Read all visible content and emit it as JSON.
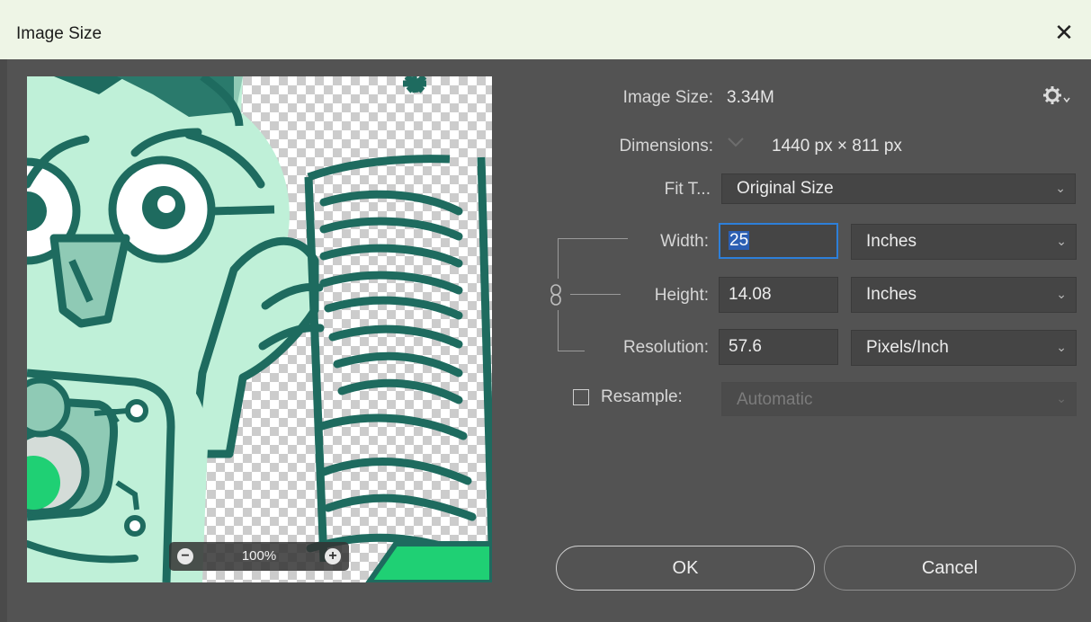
{
  "window": {
    "title": "Image Size",
    "close_glyph": "✕"
  },
  "preview": {
    "zoom_level": "100%",
    "zoom_out_glyph": "−",
    "zoom_in_glyph": "+"
  },
  "info": {
    "image_size_label": "Image Size:",
    "image_size_value": "3.34M",
    "dimensions_label": "Dimensions:",
    "dimensions_value": "1440 px  ×  811 px"
  },
  "fit_to": {
    "label": "Fit T...",
    "value": "Original Size"
  },
  "width": {
    "label": "Width:",
    "value": "25",
    "unit": "Inches"
  },
  "height": {
    "label": "Height:",
    "value": "14.08",
    "unit": "Inches"
  },
  "resolution": {
    "label": "Resolution:",
    "value": "57.6",
    "unit": "Pixels/Inch"
  },
  "resample": {
    "label": "Resample:",
    "value": "Automatic",
    "checked": false
  },
  "buttons": {
    "ok": "OK",
    "cancel": "Cancel"
  },
  "icons": [
    "gear-icon",
    "chain-link-icon",
    "chevron-down-icon",
    "close-icon",
    "zoom-out-icon",
    "zoom-in-icon"
  ],
  "colors": {
    "dialog_bg": "#535353",
    "titlebar_bg": "#eef5e6",
    "focus": "#2d7fd9",
    "accent_green": "#1fd074",
    "mint": "#bff0d8",
    "teal": "#1e6b5f"
  }
}
